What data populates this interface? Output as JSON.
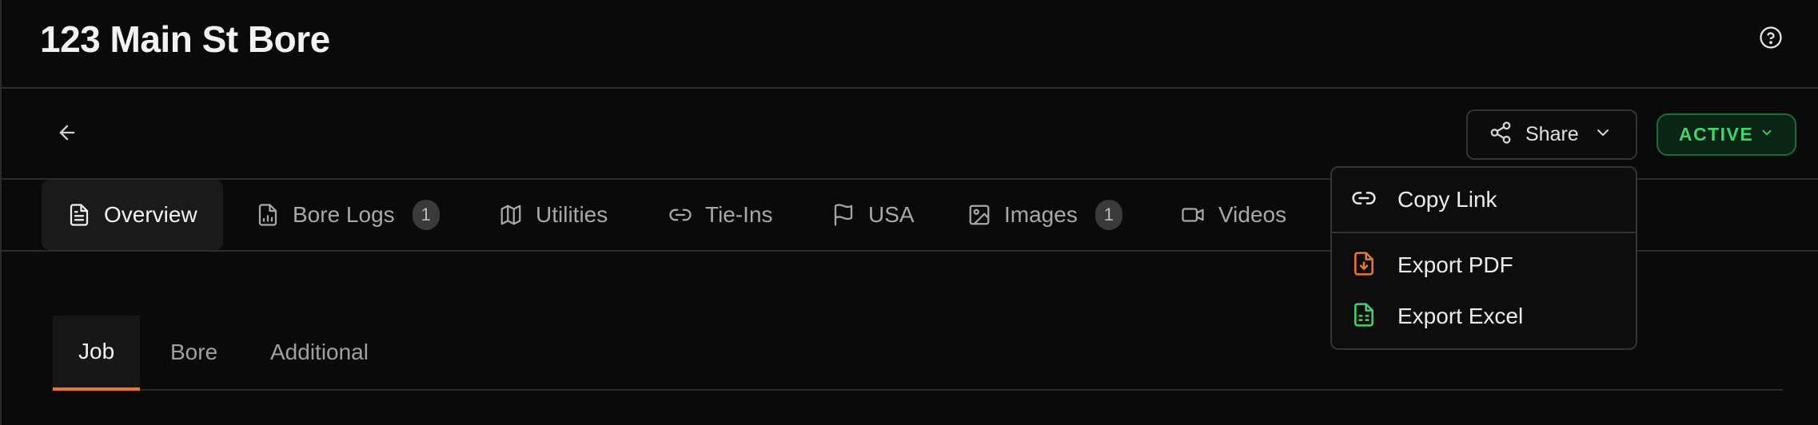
{
  "header": {
    "title": "123 Main St Bore",
    "help_icon": "help-circle-icon"
  },
  "toolbar": {
    "back_icon": "arrow-left-icon",
    "share": {
      "label": "Share",
      "icon": "share-icon",
      "chevron": "chevron-down-icon"
    },
    "status": {
      "label": "ACTIVE",
      "color": "#3fd46e",
      "chevron": "chevron-down-icon"
    }
  },
  "tabs": [
    {
      "label": "Overview",
      "icon": "document-icon",
      "active": true
    },
    {
      "label": "Bore Logs",
      "icon": "chart-file-icon",
      "count": "1"
    },
    {
      "label": "Utilities",
      "icon": "map-icon"
    },
    {
      "label": "Tie-Ins",
      "icon": "link-icon"
    },
    {
      "label": "USA",
      "icon": "flag-icon"
    },
    {
      "label": "Images",
      "icon": "image-icon",
      "count": "1"
    },
    {
      "label": "Videos",
      "icon": "video-icon"
    }
  ],
  "subtabs": [
    {
      "label": "Job",
      "active": true
    },
    {
      "label": "Bore"
    },
    {
      "label": "Additional"
    }
  ],
  "share_menu": {
    "items": [
      {
        "label": "Copy Link",
        "icon": "link-icon"
      },
      {
        "label": "Export PDF",
        "icon": "file-download-icon",
        "color": "#e9772e"
      },
      {
        "label": "Export Excel",
        "icon": "spreadsheet-icon",
        "color": "#3fd46e"
      }
    ]
  },
  "colors": {
    "accent": "#e9772e",
    "active_green": "#3fd46e",
    "background": "#0a0a0a"
  }
}
